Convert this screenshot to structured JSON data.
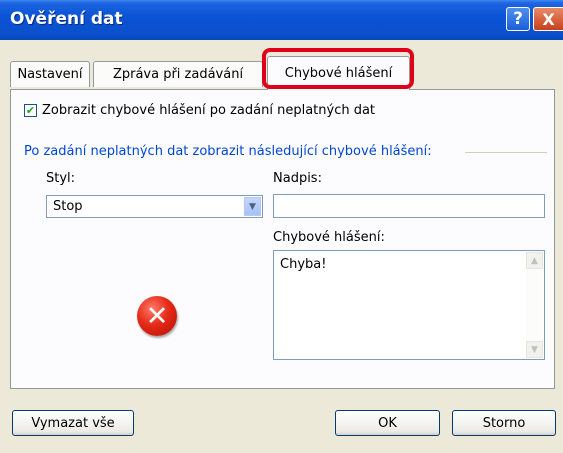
{
  "window": {
    "title": "Ověření dat",
    "help_label": "?",
    "close_label": "X"
  },
  "tabs": [
    {
      "label": "Nastavení"
    },
    {
      "label": "Zpráva při zadávání"
    },
    {
      "label": "Chybové hlášení",
      "active": true
    }
  ],
  "error_tab": {
    "show_alert_checkbox": {
      "label": "Zobrazit chybové hlášení po zadání neplatných dat",
      "checked": true
    },
    "group_label": "Po zadání neplatných dat zobrazit následující chybové hlášení:",
    "style_label": "Styl:",
    "style_value": "Stop",
    "title_label": "Nadpis:",
    "title_value": "",
    "message_label": "Chybové hlášení:",
    "message_value": "Chyba!",
    "icon": "error-stop-icon"
  },
  "buttons": {
    "clear": "Vymazat vše",
    "ok": "OK",
    "cancel": "Storno"
  },
  "colors": {
    "highlight": "#e0001a",
    "group_label": "#0046d5",
    "titlebar": "#0a54d6"
  }
}
